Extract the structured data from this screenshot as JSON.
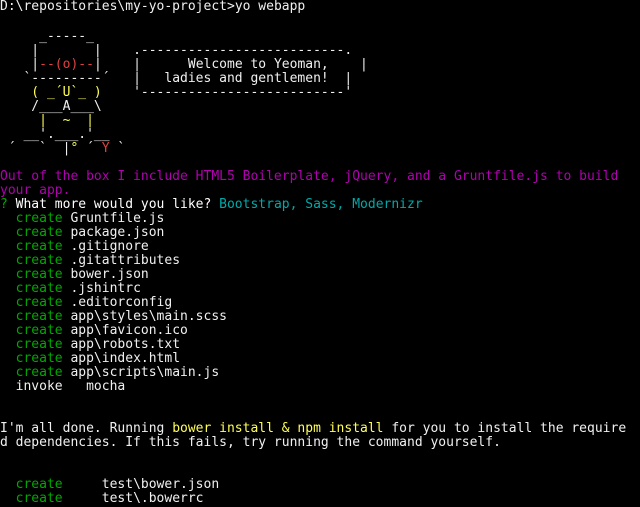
{
  "colors": {
    "background": "#000000",
    "text": "#c0c0c0",
    "prompt": "#f0f0f0",
    "yeoman_face": "#ffff55",
    "yeoman_eyes": "#e04040",
    "boilerplate_text": "#b000b0",
    "create_tag": "#00a800",
    "question_mark": "#00a800",
    "answer": "#00aaaa",
    "command_highlight": "#ffff55"
  },
  "prompt": {
    "path": "D:\\repositories\\my-yo-project>",
    "command": "yo webapp"
  },
  "yeoman_art": {
    "line1_hat": "     _-----_",
    "line2a": "    |       |    ",
    "line2b": ".--------------------------.",
    "line3a_left": "    |",
    "line3a_eyes": "--(o)--",
    "line3a_right": "|    ",
    "line3b": "|      Welcome to Yeoman,    |",
    "line4a": "   `---------´   ",
    "line4b": "|   ladies and gentlemen!  |",
    "line5a": "    ( _´U`_ )    ",
    "line5b": "'--------------------------'",
    "line6": "    /___A___\\",
    "line7": "     |  ~  |",
    "line8_left": "   __'.___.'__",
    "line9_left": " ´   `  |",
    "line9_degree": "° ",
    "line9_mid": "´ ",
    "line9_y": "Y",
    "line9_right": " `"
  },
  "intro_text": {
    "line1": "Out of the box I include HTML5 Boilerplate, jQuery, and a Gruntfile.js to build",
    "line2": "your app."
  },
  "question": {
    "marker": "?",
    "text": " What more would you like? ",
    "answer": "Bootstrap, Sass, Modernizr"
  },
  "created_files": [
    {
      "tag": "create",
      "file": "Gruntfile.js"
    },
    {
      "tag": "create",
      "file": "package.json"
    },
    {
      "tag": "create",
      "file": ".gitignore"
    },
    {
      "tag": "create",
      "file": ".gitattributes"
    },
    {
      "tag": "create",
      "file": "bower.json"
    },
    {
      "tag": "create",
      "file": ".jshintrc"
    },
    {
      "tag": "create",
      "file": ".editorconfig"
    },
    {
      "tag": "create",
      "file": "app\\styles\\main.scss"
    },
    {
      "tag": "create",
      "file": "app\\favicon.ico"
    },
    {
      "tag": "create",
      "file": "app\\robots.txt"
    },
    {
      "tag": "create",
      "file": "app\\index.html"
    },
    {
      "tag": "create",
      "file": "app\\scripts\\main.js"
    }
  ],
  "invoke": {
    "tag": "invoke",
    "target": "mocha"
  },
  "done_message": {
    "line1_prefix": "I'm all done. Running ",
    "line1_command": "bower install & npm install",
    "line1_suffix": " for you to install the require",
    "line2": "d dependencies. If this fails, try running the command yourself."
  },
  "test_files": [
    {
      "tag": "create",
      "file": "test\\bower.json"
    },
    {
      "tag": "create",
      "file": "test\\.bowerrc"
    }
  ]
}
